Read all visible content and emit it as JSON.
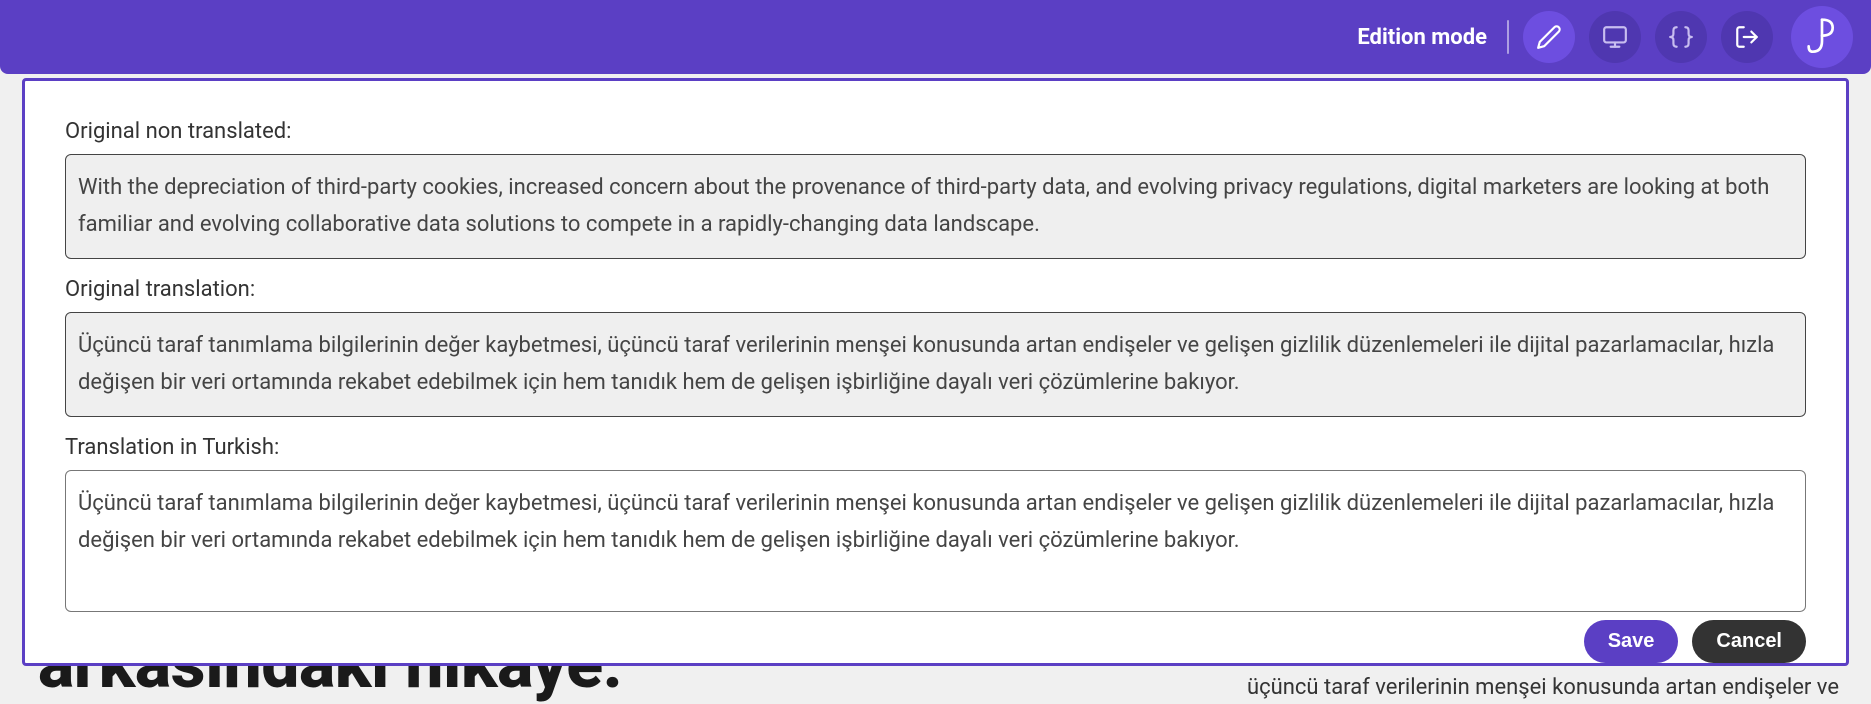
{
  "toolbar": {
    "mode_label": "Edition mode"
  },
  "background": {
    "headline_fragment": "arkasındaki hikaye.",
    "snippet_fragment": "üçüncü taraf verilerinin menşei konusunda artan endişeler ve"
  },
  "modal": {
    "labels": {
      "original_non_translated": "Original non translated:",
      "original_translation": "Original translation:",
      "translation_in_turkish": "Translation in Turkish:"
    },
    "values": {
      "original_non_translated": "With the depreciation of third-party cookies, increased concern about the provenance of third-party data, and evolving privacy regulations, digital marketers are looking at both familiar and evolving collaborative data solutions to compete in a rapidly-changing data landscape.",
      "original_translation": "Üçüncü taraf tanımlama bilgilerinin değer kaybetmesi, üçüncü taraf verilerinin menşei konusunda artan endişeler ve gelişen gizlilik düzenlemeleri ile dijital pazarlamacılar, hızla değişen bir veri ortamında rekabet edebilmek için hem tanıdık hem de gelişen işbirliğine dayalı veri çözümlerine bakıyor.",
      "translation_in_turkish": "Üçüncü taraf tanımlama bilgilerinin değer kaybetmesi, üçüncü taraf verilerinin menşei konusunda artan endişeler ve gelişen gizlilik düzenlemeleri ile dijital pazarlamacılar, hızla değişen bir veri ortamında rekabet edebilmek için hem tanıdık hem de gelişen işbirliğine dayalı veri çözümlerine bakıyor."
    },
    "buttons": {
      "save": "Save",
      "cancel": "Cancel"
    }
  }
}
